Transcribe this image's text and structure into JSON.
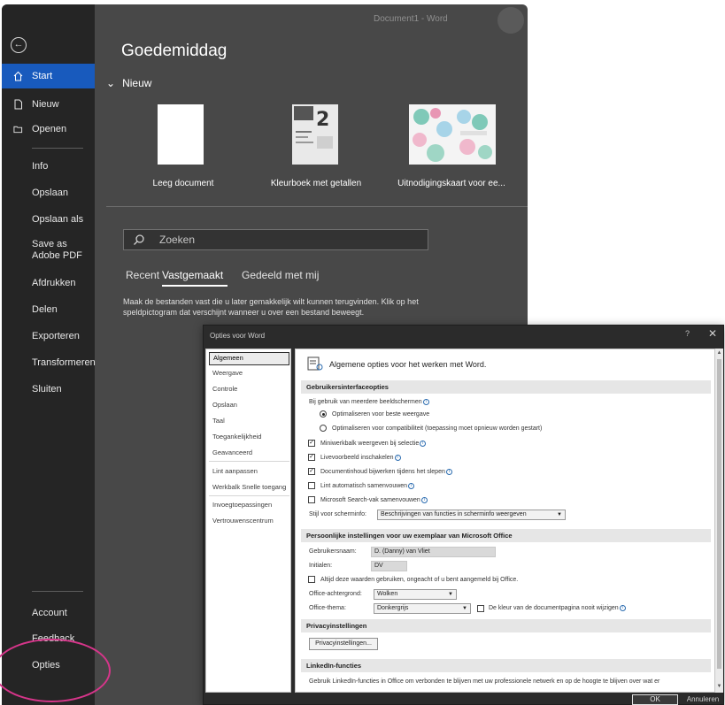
{
  "word": {
    "window_title": "Document1  -  Word",
    "greeting": "Goedemiddag",
    "new_section": "Nieuw",
    "sidebar": {
      "items": [
        {
          "label": "Start"
        },
        {
          "label": "Nieuw"
        },
        {
          "label": "Openen"
        },
        {
          "label": "Info"
        },
        {
          "label": "Opslaan"
        },
        {
          "label": "Opslaan als"
        },
        {
          "label": "Save as Adobe PDF"
        },
        {
          "label": "Afdrukken"
        },
        {
          "label": "Delen"
        },
        {
          "label": "Exporteren"
        },
        {
          "label": "Transformeren"
        },
        {
          "label": "Sluiten"
        },
        {
          "label": "Account"
        },
        {
          "label": "Feedback"
        },
        {
          "label": "Opties"
        }
      ]
    },
    "templates": [
      {
        "caption": "Leeg document"
      },
      {
        "caption": "Kleurboek met getallen"
      },
      {
        "caption": "Uitnodigingskaart voor ee..."
      }
    ],
    "search_placeholder": "Zoeken",
    "tabs": [
      {
        "label": "Recent"
      },
      {
        "label": "Vastgemaakt"
      },
      {
        "label": "Gedeeld met mij"
      }
    ],
    "pinned_text": "Maak de bestanden vast die u later gemakkelijk wilt kunnen terugvinden. Klik op het speldpictogram dat verschijnt wanneer u over een bestand beweegt."
  },
  "dialog": {
    "title": "Opties voor Word",
    "help": "?",
    "close": "✕",
    "nav": [
      {
        "label": "Algemeen"
      },
      {
        "label": "Weergave"
      },
      {
        "label": "Controle"
      },
      {
        "label": "Opslaan"
      },
      {
        "label": "Taal"
      },
      {
        "label": "Toegankelijkheid"
      },
      {
        "label": "Geavanceerd"
      },
      {
        "label": "Lint aanpassen"
      },
      {
        "label": "Werkbalk Snelle toegang"
      },
      {
        "label": "Invoegtoepassingen"
      },
      {
        "label": "Vertrouwenscentrum"
      }
    ],
    "heading": "Algemene opties voor het werken met Word.",
    "ui_section": "Gebruikersinterfaceopties",
    "multi_screen_label": "Bij gebruik van meerdere beeldschermen",
    "radio_best": "Optimaliseren voor beste weergave",
    "radio_compat": "Optimaliseren voor compatibiliteit (toepassing moet opnieuw worden gestart)",
    "cb_minibar": "Miniwerkbalk weergeven bij selectie",
    "cb_live": "Livevoorbeeld inschakelen",
    "cb_drag": "Documentinhoud bijwerken tijdens het slepen",
    "cb_ribbon": "Lint automatisch samenvouwen",
    "cb_search": "Microsoft Search-vak samenvouwen",
    "screentip_label": "Stijl voor scherminfo:",
    "screentip_value": "Beschrijvingen van functies in scherminfo weergeven",
    "personal_section": "Persoonlijke instellingen voor uw exemplaar van Microsoft Office",
    "username_label": "Gebruikersnaam:",
    "username_value": "D. (Danny) van Vliet",
    "initials_label": "Initialen:",
    "initials_value": "DV",
    "cb_always": "Altijd deze waarden gebruiken, ongeacht of u bent aangemeld bij Office.",
    "bg_label": "Office-achtergrond:",
    "bg_value": "Wolken",
    "theme_label": "Office-thema:",
    "theme_value": "Donkergrijs",
    "cb_pagecolor": "De kleur van de documentpagina nooit wijzigen",
    "privacy_section": "Privacyinstellingen",
    "privacy_button": "Privacyinstellingen...",
    "linkedin_section": "LinkedIn-functies",
    "linkedin_text": "Gebruik LinkedIn-functies in Office om verbonden te blijven met uw professionele netwerk en op de hoogte te blijven over wat er",
    "ok": "OK",
    "cancel": "Annuleren"
  },
  "colors": {
    "word_bg": "#484848",
    "sidebar_bg": "#252525",
    "accent_blue": "#185abd",
    "highlight": "#d6358a"
  }
}
